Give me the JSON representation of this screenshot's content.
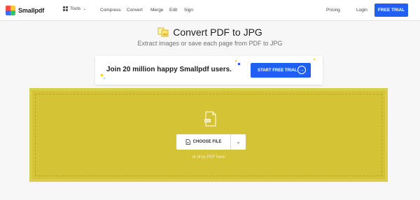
{
  "nav": {
    "brand": "Smallpdf",
    "tools_label": "Tools",
    "links": [
      "Compress",
      "Convert",
      "Merge",
      "Edit",
      "Sign"
    ],
    "pricing": "Pricing",
    "login": "Login",
    "trial_button": "FREE TRIAL"
  },
  "hero": {
    "title": "Convert PDF to JPG",
    "subtitle": "Extract images or save each page from PDF to JPG"
  },
  "banner": {
    "text": "Join 20 million happy Smallpdf users.",
    "button": "START FREE TRIAL"
  },
  "dropzone": {
    "choose_label": "CHOOSE FILE",
    "hint": "or drop PDF here"
  },
  "colors": {
    "accent_blue": "#1f5ff2",
    "dropzone_yellow": "#d4c335"
  }
}
